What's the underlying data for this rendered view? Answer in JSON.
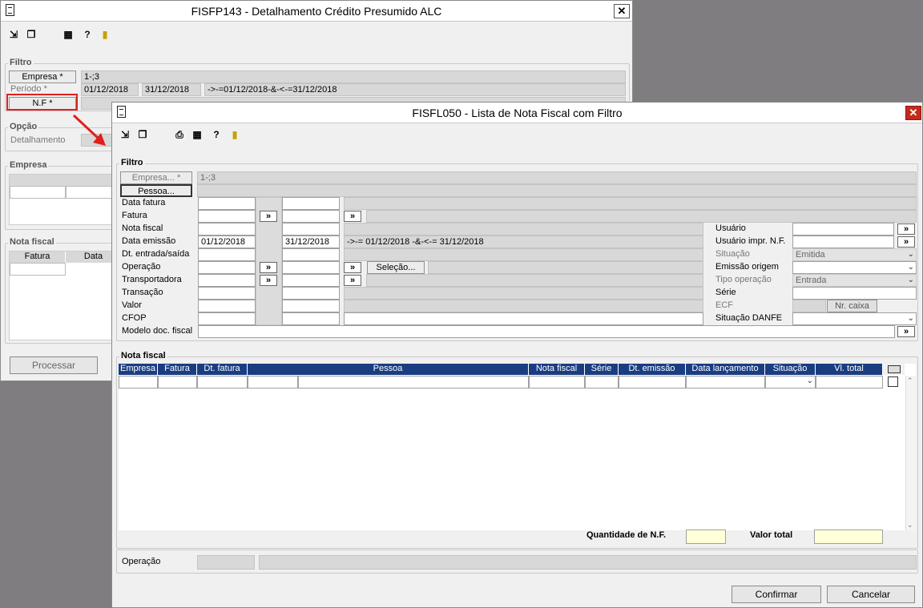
{
  "back": {
    "title": "FISFP143 - Detalhamento Crédito Presumido ALC",
    "close": "✕",
    "filtro": "Filtro",
    "empresa_btn": "Empresa *",
    "empresa_val": "1-;3",
    "periodo_lbl": "Período *",
    "periodo_ini": "01/12/2018",
    "periodo_fim": "31/12/2018",
    "periodo_expr": "->-=01/12/2018-&-<-=31/12/2018",
    "nf_btn": "N.F *",
    "opcao": "Opção",
    "detalhamento": "Detalhamento",
    "empresa_grp": "Empresa",
    "nota_grp": "Nota fiscal",
    "col_fatura": "Fatura",
    "col_data": "Data",
    "processar": "Processar"
  },
  "front": {
    "title": "FISFL050 - Lista de Nota Fiscal com Filtro",
    "close": "✕",
    "filtro": "Filtro",
    "empresa_btn": "Empresa... *",
    "empresa_val": "1-;3",
    "pessoa_btn": "Pessoa...",
    "labels": {
      "data_fatura": "Data fatura",
      "fatura": "Fatura",
      "nota_fiscal": "Nota fiscal",
      "data_emissao": "Data emissão",
      "dt_entrada": "Dt. entrada/saída",
      "operacao": "Operação",
      "transportadora": "Transportadora",
      "transacao": "Transação",
      "valor": "Valor",
      "cfop": "CFOP",
      "modelo": "Modelo doc. fiscal",
      "usuario": "Usuário",
      "usuario_impr": "Usuário impr. N.F.",
      "situacao": "Situação",
      "emissao_origem": "Emissão origem",
      "tipo_operacao": "Tipo operação",
      "serie": "Série",
      "ecf": "ECF",
      "situacao_danfe": "Situação DANFE"
    },
    "arrow": "»",
    "data_emissao_ini": "01/12/2018",
    "data_emissao_fim": "31/12/2018",
    "data_emissao_expr": "->-= 01/12/2018 -&-<-= 31/12/2018",
    "selecao_btn": "Seleção...",
    "situacao_val": "Emitida",
    "tipo_operacao_val": "Entrada",
    "nr_caixa_btn": "Nr. caixa",
    "nota_grp": "Nota fiscal",
    "columns": [
      "Empresa",
      "Fatura",
      "Dt. fatura",
      "Pessoa",
      "Nota fiscal",
      "Série",
      "Dt. emissão",
      "Data lançamento",
      "Situação",
      "Vl. total"
    ],
    "qtd_lbl": "Quantidade de N.F.",
    "valor_total_lbl": "Valor total",
    "operacao_lbl": "Operação",
    "confirmar": "Confirmar",
    "cancelar": "Cancelar"
  },
  "colors": {
    "highlight": "#e02020",
    "header_selected": "#1a3d82",
    "total_fields": "#ffffd8"
  }
}
